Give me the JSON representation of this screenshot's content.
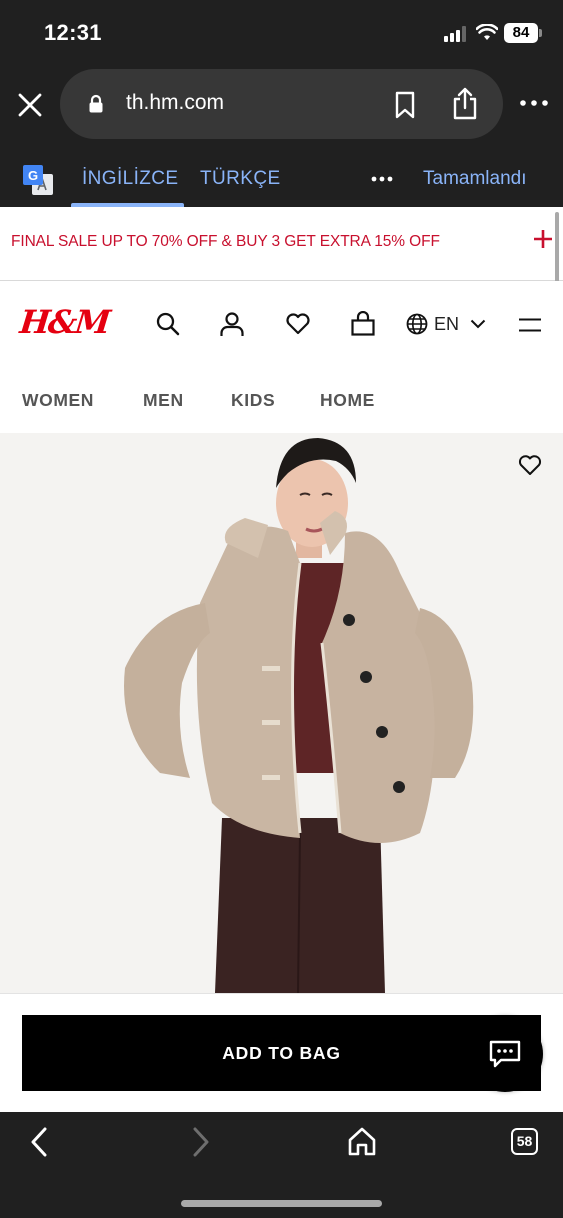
{
  "status_bar": {
    "time": "12:31",
    "battery": "84"
  },
  "browser": {
    "url": "th.hm.com"
  },
  "translate_bar": {
    "source_lang": "İNGİLİZCE",
    "target_lang": "TÜRKÇE",
    "done_label": "Tamamlandı"
  },
  "promo": {
    "text": "FINAL SALE UP TO 70% OFF & BUY 3 GET EXTRA 15% OFF"
  },
  "header": {
    "logo": "H&M",
    "language": "EN"
  },
  "nav": {
    "categories": [
      "WOMEN",
      "MEN",
      "KIDS",
      "HOME"
    ]
  },
  "product": {
    "add_to_bag_label": "ADD TO BAG"
  },
  "bottom_bar": {
    "tab_count": "58"
  },
  "colors": {
    "brand_red": "#e50010",
    "promo_red": "#c8102e",
    "link_blue": "#8ab4f8",
    "chrome_dark": "#202020"
  }
}
